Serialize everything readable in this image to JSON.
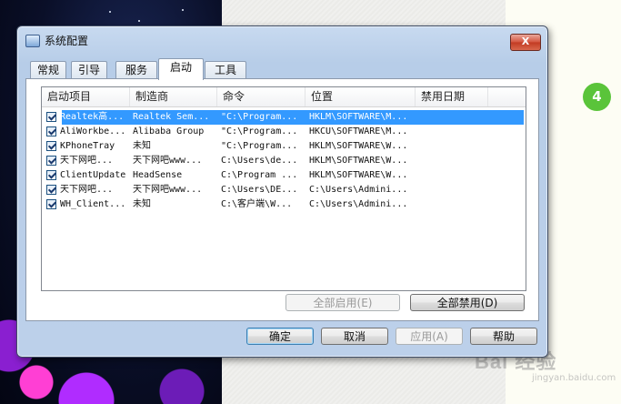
{
  "window": {
    "title": "系统配置",
    "close_glyph": "X"
  },
  "tabs": [
    {
      "label": "常规"
    },
    {
      "label": "引导"
    },
    {
      "label": "服务"
    },
    {
      "label": "启动",
      "active": true
    },
    {
      "label": "工具"
    }
  ],
  "startup": {
    "columns": [
      "启动项目",
      "制造商",
      "命令",
      "位置",
      "禁用日期"
    ],
    "rows": [
      {
        "checked": true,
        "item": "Realtek高...",
        "maker": "Realtek Sem...",
        "command": "\"C:\\Program...",
        "location": "HKLM\\SOFTWARE\\M...",
        "disabled_date": "",
        "selected": true
      },
      {
        "checked": true,
        "item": "AliWorkbe...",
        "maker": "Alibaba Group",
        "command": "\"C:\\Program...",
        "location": "HKCU\\SOFTWARE\\M...",
        "disabled_date": ""
      },
      {
        "checked": true,
        "item": "KPhoneTray",
        "maker": "未知",
        "command": "\"C:\\Program...",
        "location": "HKLM\\SOFTWARE\\W...",
        "disabled_date": ""
      },
      {
        "checked": true,
        "item": "天下网吧...",
        "maker": "天下网吧www...",
        "command": "C:\\Users\\de...",
        "location": "HKLM\\SOFTWARE\\W...",
        "disabled_date": ""
      },
      {
        "checked": true,
        "item": "ClientUpdate",
        "maker": "HeadSense",
        "command": "C:\\Program ...",
        "location": "HKLM\\SOFTWARE\\W...",
        "disabled_date": ""
      },
      {
        "checked": true,
        "item": "天下网吧...",
        "maker": "天下网吧www...",
        "command": "C:\\Users\\DE...",
        "location": "C:\\Users\\Admini...",
        "disabled_date": ""
      },
      {
        "checked": true,
        "item": "WH_Client...",
        "maker": "未知",
        "command": "C:\\客户端\\W...",
        "location": "C:\\Users\\Admini...",
        "disabled_date": ""
      }
    ],
    "enable_all_label": "全部启用(E)",
    "disable_all_label": "全部禁用(D)"
  },
  "footer": {
    "ok_label": "确定",
    "cancel_label": "取消",
    "apply_label": "应用(A)",
    "help_label": "帮助"
  },
  "overlay": {
    "step_number": "4",
    "watermark": "Bai 经验",
    "watermark_sub": "jingyan.baidu.com"
  },
  "colors": {
    "selection": "#3399ff",
    "badge": "#5ac43a",
    "close_button": "#c8452d"
  }
}
